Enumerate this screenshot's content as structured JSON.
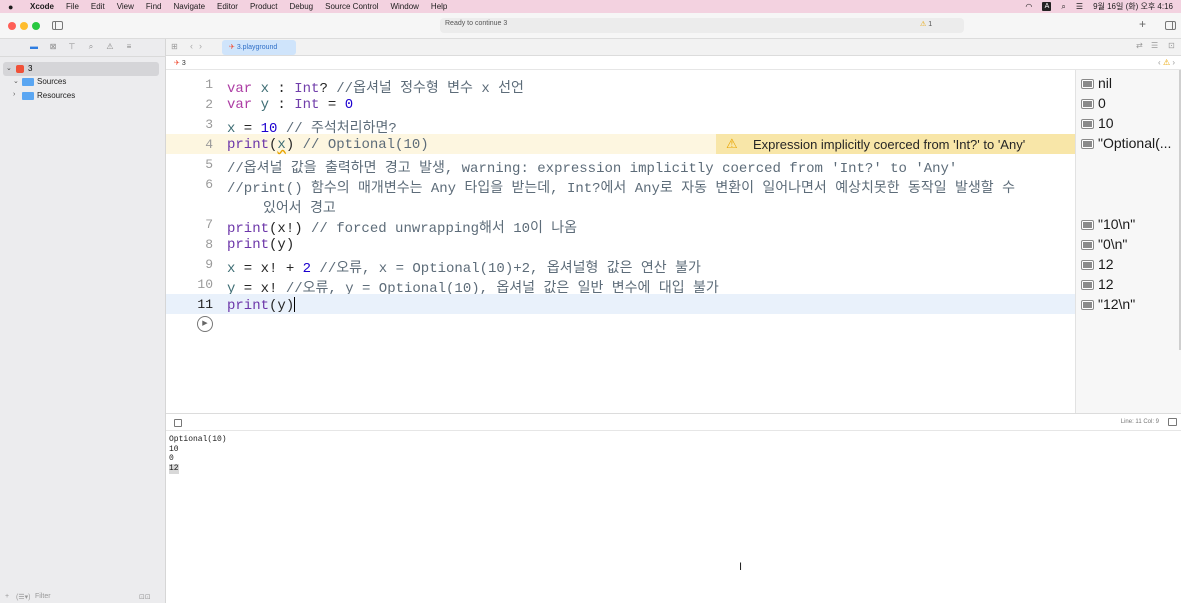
{
  "menubar": {
    "app": "Xcode",
    "items": [
      "File",
      "Edit",
      "View",
      "Find",
      "Navigate",
      "Editor",
      "Product",
      "Debug",
      "Source Control",
      "Window",
      "Help"
    ],
    "datetime": "9월 16일 (화) 오후 4:16",
    "input_source": "A"
  },
  "toolbar": {
    "status": "Ready to continue 3",
    "warning_count": "1"
  },
  "navigator": {
    "project": "3",
    "items": [
      {
        "label": "Sources"
      },
      {
        "label": "Resources"
      }
    ],
    "filter_placeholder": "Filter"
  },
  "editor": {
    "tab_label": "3.playground",
    "breadcrumb": "3",
    "jump_warning": "1",
    "lines": [
      {
        "num": "1"
      },
      {
        "num": "2"
      },
      {
        "num": "3"
      },
      {
        "num": "4"
      },
      {
        "num": "5"
      },
      {
        "num": "6"
      },
      {
        "num": "7"
      },
      {
        "num": "8"
      },
      {
        "num": "9"
      },
      {
        "num": "10"
      },
      {
        "num": "11"
      }
    ],
    "code": {
      "l1_kw": "var",
      "l1_var": "x",
      "l1_colon": " : ",
      "l1_type": "Int",
      "l1_q": "? ",
      "l1_comment": "//옵셔널 정수형 변수 x 선언",
      "l2_kw": "var",
      "l2_var": "y",
      "l2_colon": " : ",
      "l2_type": "Int",
      "l2_eq": " = ",
      "l2_num": "0",
      "l3_var": "x",
      "l3_eq": " = ",
      "l3_num": "10",
      "l3_comment": " // 주석처리하면?",
      "l4_fn": "print",
      "l4_open": "(",
      "l4_arg": "x",
      "l4_close": ")",
      "l4_comment": " // Optional(10)",
      "l5_comment": "//옵셔널 값을 출력하면 경고 발생, warning: expression implicitly coerced from 'Int?' to 'Any'",
      "l6_comment": "//print() 함수의 매개변수는 Any 타입을 받는데, Int?에서 Any로 자동 변환이 일어나면서 예상치못한 동작일 발생할 수",
      "l6_comment_wrap": "있어서 경고",
      "l7_fn": "print",
      "l7_rest": "(x!)",
      "l7_comment": " // forced unwrapping해서 10이 나옴",
      "l8_fn": "print",
      "l8_rest": "(y)",
      "l9_a": "x",
      "l9_b": " = x! + ",
      "l9_num": "2",
      "l9_comment": " //오류, x = Optional(10)+2, 옵셔널형 값은 연산 불가",
      "l10_a": "y",
      "l10_b": " = x! ",
      "l10_comment": "//오류, y = Optional(10), 옵셔널 값은 일반 변수에 대입 불가",
      "l11_fn": "print",
      "l11_rest": "(y)"
    },
    "warning_message": "Expression implicitly coerced from 'Int?' to 'Any'"
  },
  "results": [
    {
      "text": "nil"
    },
    {
      "text": "0"
    },
    {
      "text": "10"
    },
    {
      "text": "\"Optional(..."
    },
    {
      "text": "\"10\\n\""
    },
    {
      "text": "\"0\\n\""
    },
    {
      "text": "12"
    },
    {
      "text": "12"
    },
    {
      "text": "\"12\\n\""
    }
  ],
  "debug": {
    "line_col": "Line: 11  Col: 9",
    "console_lines": [
      "Optional(10)",
      "10",
      "0",
      "12"
    ]
  }
}
